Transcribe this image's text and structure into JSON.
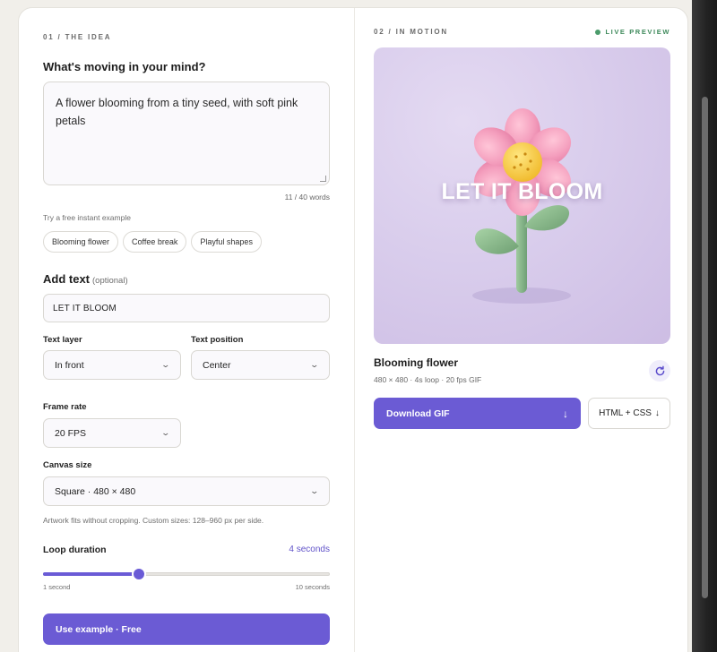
{
  "colors": {
    "accent": "#6b5bd4",
    "live": "#3f8a5c",
    "preview_bg": "#d9cdec",
    "petal": "#f2a4bf",
    "stem": "#86b58c"
  },
  "left": {
    "section_label": "01 / THE IDEA",
    "prompt_heading": "What's moving in your mind?",
    "prompt_value": "A flower blooming from a tiny seed, with soft pink petals",
    "word_count": "11 / 40 words",
    "examples_label": "Try a free instant example",
    "examples": [
      "Blooming flower",
      "Coffee break",
      "Playful shapes"
    ],
    "add_text_heading": "Add text",
    "add_text_optional": "(optional)",
    "text_value": "LET IT BLOOM",
    "text_layer_label": "Text layer",
    "text_layer_value": "In front",
    "text_position_label": "Text position",
    "text_position_value": "Center",
    "frame_rate_label": "Frame rate",
    "frame_rate_value": "20 FPS",
    "canvas_size_label": "Canvas size",
    "canvas_size_value": "Square · 480 × 480",
    "canvas_hint": "Artwork fits without cropping. Custom sizes: 128–960 px per side.",
    "loop_label": "Loop duration",
    "loop_value_text": "4 seconds",
    "loop_seconds": 4,
    "loop_min_seconds": 1,
    "loop_max_seconds": 10,
    "loop_min_label": "1 second",
    "loop_max_label": "10 seconds",
    "use_example_button": "Use example · Free"
  },
  "right": {
    "section_label": "02 / IN MOTION",
    "live_label": "LIVE PREVIEW",
    "preview_overlay_text": "LET IT BLOOM",
    "preview_title": "Blooming flower",
    "preview_meta": "480 × 480 · 4s loop · 20 fps GIF",
    "download_button": "Download GIF",
    "download_icon": "arrow-down-icon",
    "html_css_button": "HTML + CSS",
    "refresh_icon": "refresh-icon"
  }
}
